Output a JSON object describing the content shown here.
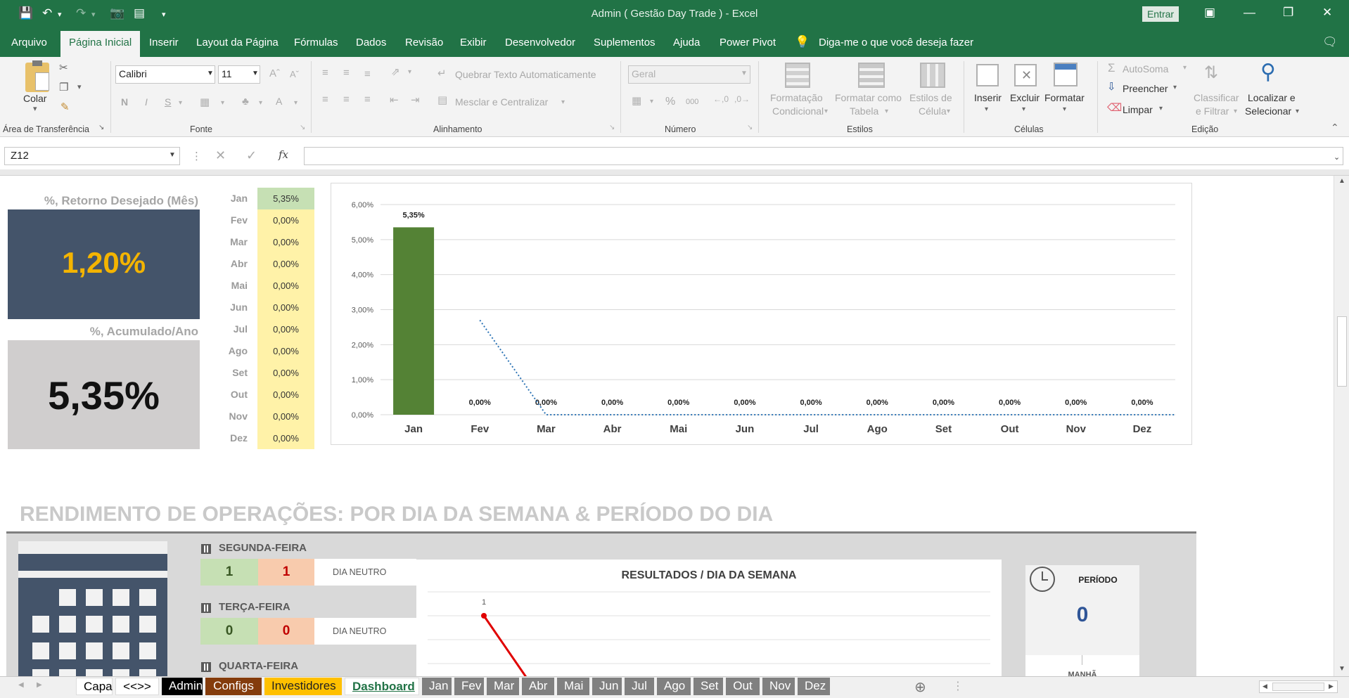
{
  "window": {
    "title": "Admin ( Gestão Day Trade )  -  Excel",
    "signin_label": "Entrar"
  },
  "menu": {
    "tabs": [
      "Arquivo",
      "Página Inicial",
      "Inserir",
      "Layout da Página",
      "Fórmulas",
      "Dados",
      "Revisão",
      "Exibir",
      "Desenvolvedor",
      "Suplementos",
      "Ajuda",
      "Power Pivot"
    ],
    "active_tab": "Página Inicial",
    "tell_me": "Diga-me o que você deseja fazer"
  },
  "ribbon": {
    "clipboard": {
      "paste": "Colar",
      "group": "Área de Transferência"
    },
    "font": {
      "name": "Calibri",
      "size": "11",
      "group": "Fonte",
      "bold": "N",
      "italic": "I",
      "underline": "S",
      "grow": "A",
      "color": "A"
    },
    "alignment": {
      "wrap": "Quebrar Texto Automaticamente",
      "merge": "Mesclar e Centralizar",
      "group": "Alinhamento"
    },
    "number": {
      "format": "Geral",
      "group": "Número",
      "percent": "%",
      "thousands": "000"
    },
    "styles": {
      "conditional_1": "Formatação",
      "conditional_2": "Condicional",
      "table_1": "Formatar como",
      "table_2": "Tabela",
      "cell_1": "Estilos de",
      "cell_2": "Célula",
      "group": "Estilos"
    },
    "cells": {
      "insert": "Inserir",
      "delete": "Excluir",
      "format": "Formatar",
      "group": "Células"
    },
    "editing": {
      "autosum": "AutoSoma",
      "fill": "Preencher",
      "clear": "Limpar",
      "sort_1": "Classificar",
      "sort_2": "e Filtrar",
      "find_1": "Localizar e",
      "find_2": "Selecionar",
      "group": "Edição"
    }
  },
  "formula_bar": {
    "name_box": "Z12",
    "fx": "fx",
    "formula": ""
  },
  "dashboard": {
    "kpi_desired_label": "%, Retorno Desejado (Mês)",
    "kpi_desired_value": "1,20%",
    "kpi_accum_label": "%, Acumulado/Ano",
    "kpi_accum_value": "5,35%",
    "months": [
      {
        "m": "Jan",
        "v": "5,35%"
      },
      {
        "m": "Fev",
        "v": "0,00%"
      },
      {
        "m": "Mar",
        "v": "0,00%"
      },
      {
        "m": "Abr",
        "v": "0,00%"
      },
      {
        "m": "Mai",
        "v": "0,00%"
      },
      {
        "m": "Jun",
        "v": "0,00%"
      },
      {
        "m": "Jul",
        "v": "0,00%"
      },
      {
        "m": "Ago",
        "v": "0,00%"
      },
      {
        "m": "Set",
        "v": "0,00%"
      },
      {
        "m": "Out",
        "v": "0,00%"
      },
      {
        "m": "Nov",
        "v": "0,00%"
      },
      {
        "m": "Dez",
        "v": "0,00%"
      }
    ],
    "section_title": "RENDIMENTO DE OPERAÇÕES: POR DIA DA SEMANA & PERÍODO DO DIA",
    "weekdays": [
      {
        "name": "SEGUNDA-FEIRA",
        "wins": "1",
        "losses": "1",
        "status": "DIA NEUTRO"
      },
      {
        "name": "TERÇA-FEIRA",
        "wins": "0",
        "losses": "0",
        "status": "DIA NEUTRO"
      },
      {
        "name": "QUARTA-FEIRA"
      }
    ],
    "weekday_chart_title": "RESULTADOS / DIA DA SEMANA",
    "weekday_chart_point_label": "1",
    "period": {
      "title": "PERÍODO",
      "value": "0",
      "sub": "MANHÃ"
    },
    "colors": {
      "navy": "#44546a",
      "gold": "#f4b400",
      "green": "#548235",
      "win": "#c6e0b4",
      "loss": "#f8cbad"
    }
  },
  "chart_data": [
    {
      "type": "bar",
      "categories": [
        "Jan",
        "Fev",
        "Mar",
        "Abr",
        "Mai",
        "Jun",
        "Jul",
        "Ago",
        "Set",
        "Out",
        "Nov",
        "Dez"
      ],
      "values": [
        5.35,
        0,
        0,
        0,
        0,
        0,
        0,
        0,
        0,
        0,
        0,
        0
      ],
      "data_labels": [
        "5,35%",
        "0,00%",
        "0,00%",
        "0,00%",
        "0,00%",
        "0,00%",
        "0,00%",
        "0,00%",
        "0,00%",
        "0,00%",
        "0,00%",
        "0,00%"
      ],
      "ylim": [
        0,
        6
      ],
      "yticks": [
        "0,00%",
        "1,00%",
        "2,00%",
        "3,00%",
        "4,00%",
        "5,00%",
        "6,00%"
      ],
      "grid": true,
      "trendline": "dotted"
    },
    {
      "type": "line",
      "title": "RESULTADOS / DIA DA SEMANA",
      "x": [
        "SEGUNDA-FEIRA",
        "TERÇA-FEIRA"
      ],
      "values": [
        1,
        0
      ],
      "data_labels": [
        "1"
      ]
    }
  ],
  "sheet_tabs": [
    {
      "name": "Capa",
      "bg": "#ffffff",
      "fg": "#000000"
    },
    {
      "name": "<<>>",
      "bg": "#ffffff",
      "fg": "#000000"
    },
    {
      "name": "Admin",
      "bg": "#000000",
      "fg": "#ffffff"
    },
    {
      "name": "Configs",
      "bg": "#843c0c",
      "fg": "#ffffff"
    },
    {
      "name": "Investidores",
      "bg": "#ffc000",
      "fg": "#222222"
    },
    {
      "name": "Dashboard",
      "bg": "#ffffff",
      "fg": "#217346",
      "active": true
    },
    {
      "name": "Jan",
      "bg": "#808080",
      "fg": "#ffffff"
    },
    {
      "name": "Fev",
      "bg": "#808080",
      "fg": "#ffffff"
    },
    {
      "name": "Mar",
      "bg": "#808080",
      "fg": "#ffffff"
    },
    {
      "name": "Abr",
      "bg": "#808080",
      "fg": "#ffffff"
    },
    {
      "name": "Mai",
      "bg": "#808080",
      "fg": "#ffffff"
    },
    {
      "name": "Jun",
      "bg": "#808080",
      "fg": "#ffffff"
    },
    {
      "name": "Jul",
      "bg": "#808080",
      "fg": "#ffffff"
    },
    {
      "name": "Ago",
      "bg": "#808080",
      "fg": "#ffffff"
    },
    {
      "name": "Set",
      "bg": "#808080",
      "fg": "#ffffff"
    },
    {
      "name": "Out",
      "bg": "#808080",
      "fg": "#ffffff"
    },
    {
      "name": "Nov",
      "bg": "#808080",
      "fg": "#ffffff"
    },
    {
      "name": "Dez",
      "bg": "#808080",
      "fg": "#ffffff"
    }
  ]
}
